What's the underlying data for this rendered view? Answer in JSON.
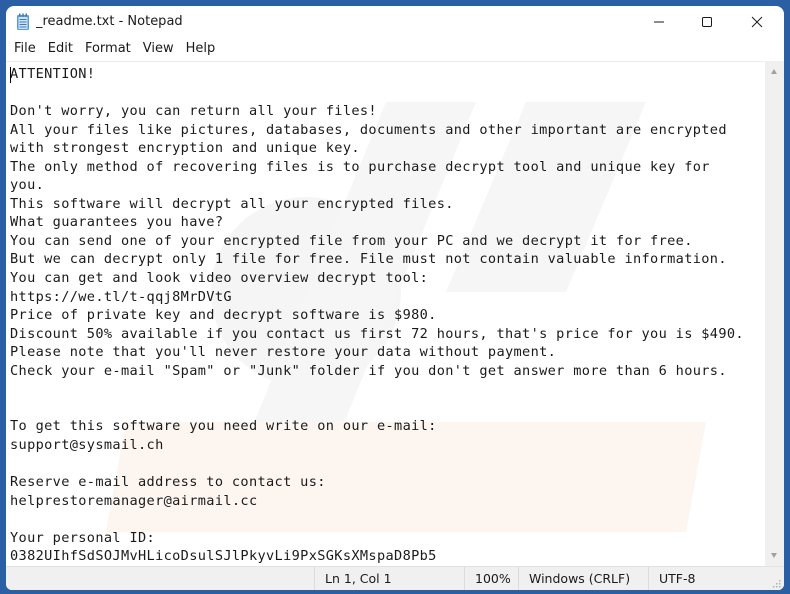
{
  "window": {
    "title": "_readme.txt - Notepad",
    "controls": {
      "minimize": "minimize",
      "maximize": "maximize",
      "close": "close"
    }
  },
  "menu": {
    "items": [
      {
        "label": "File"
      },
      {
        "label": "Edit"
      },
      {
        "label": "Format"
      },
      {
        "label": "View"
      },
      {
        "label": "Help"
      }
    ]
  },
  "document": {
    "content": "ATTENTION!\n\nDon't worry, you can return all your files!\nAll your files like pictures, databases, documents and other important are encrypted\nwith strongest encryption and unique key.\nThe only method of recovering files is to purchase decrypt tool and unique key for\nyou.\nThis software will decrypt all your encrypted files.\nWhat guarantees you have?\nYou can send one of your encrypted file from your PC and we decrypt it for free.\nBut we can decrypt only 1 file for free. File must not contain valuable information.\nYou can get and look video overview decrypt tool:\nhttps://we.tl/t-qqj8MrDVtG\nPrice of private key and decrypt software is $980.\nDiscount 50% available if you contact us first 72 hours, that's price for you is $490.\nPlease note that you'll never restore your data without payment.\nCheck your e-mail \"Spam\" or \"Junk\" folder if you don't get answer more than 6 hours.\n\n\nTo get this software you need write on our e-mail:\nsupport@sysmail.ch\n\nReserve e-mail address to contact us:\nhelprestoremanager@airmail.cc\n\nYour personal ID:\n0382UIhfSdSOJMvHLicoDsulSJlPkyvLi9PxSGKsXMspaD8Pb5"
  },
  "statusbar": {
    "position": "Ln 1, Col 1",
    "zoom": "100%",
    "line_ending": "Windows (CRLF)",
    "encoding": "UTF-8"
  },
  "colors": {
    "desktop": "#2b5fa3",
    "window_bg": "#ffffff",
    "statusbar_bg": "#f0f0f0",
    "text": "#1a1a1a"
  }
}
